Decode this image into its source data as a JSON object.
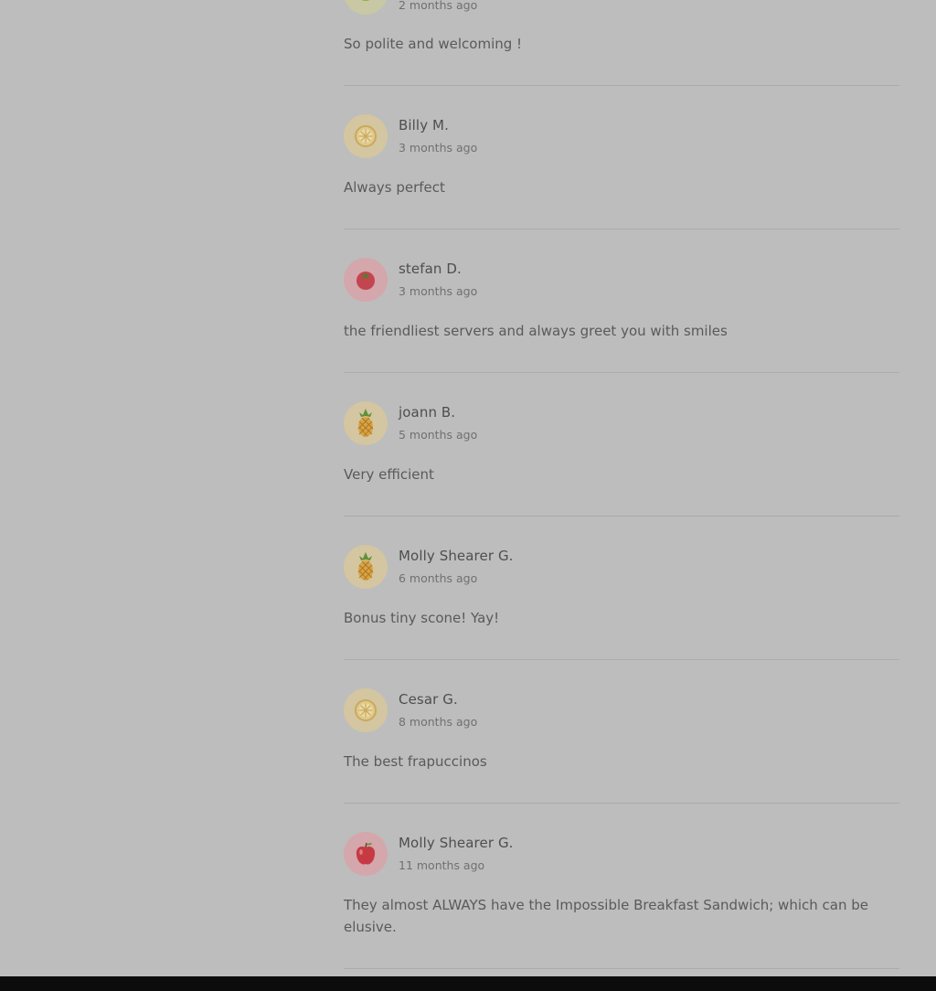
{
  "reviews": [
    {
      "name": "",
      "time": "2 months ago",
      "text": "So polite and welcoming !",
      "avatar": "lime-icon",
      "avatar_bg": "#c8c9a4"
    },
    {
      "name": "Billy M.",
      "time": "3 months ago",
      "text": "Always perfect",
      "avatar": "lemon-slice-icon",
      "avatar_bg": "#d3c6a0"
    },
    {
      "name": "stefan D.",
      "time": "3 months ago",
      "text": "the friendliest servers and always greet you with smiles",
      "avatar": "tomato-icon",
      "avatar_bg": "#d3a7ab"
    },
    {
      "name": "joann B.",
      "time": "5 months ago",
      "text": "Very efficient",
      "avatar": "pineapple-icon",
      "avatar_bg": "#d3c6a0"
    },
    {
      "name": "Molly Shearer G.",
      "time": "6 months ago",
      "text": "Bonus tiny scone! Yay!",
      "avatar": "pineapple-icon",
      "avatar_bg": "#d3c6a0"
    },
    {
      "name": "Cesar G.",
      "time": "8 months ago",
      "text": "The best frapuccinos",
      "avatar": "lemon-slice-icon",
      "avatar_bg": "#d3c6a0"
    },
    {
      "name": "Molly Shearer G.",
      "time": "11 months ago",
      "text": "They almost ALWAYS have the Impossible Breakfast Sandwich; which can be elusive.",
      "avatar": "apple-icon",
      "avatar_bg": "#d3a7ab"
    }
  ]
}
